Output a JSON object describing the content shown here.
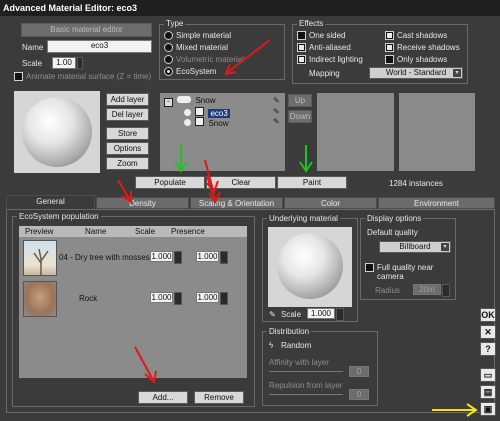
{
  "window": {
    "title": "Advanced Material Editor: eco3"
  },
  "left_panel": {
    "basic_editor_button": "Basic material editor",
    "name_label": "Name",
    "name_value": "eco3",
    "scale_label": "Scale",
    "scale_value": "1.00",
    "animate_label": "Animate material surface (Z = time)",
    "buttons": {
      "add_layer": "Add layer",
      "del_layer": "Del layer",
      "store": "Store",
      "options": "Options",
      "zoom": "Zoom"
    }
  },
  "type_group": {
    "title": "Type",
    "options": [
      "Simple material",
      "Mixed material",
      "Volumetric material",
      "EcoSystem"
    ],
    "selected": "EcoSystem"
  },
  "effects_group": {
    "title": "Effects",
    "left": [
      {
        "label": "One sided",
        "checked": false
      },
      {
        "label": "Anti-aliased",
        "checked": true
      },
      {
        "label": "Indirect lighting",
        "checked": true
      }
    ],
    "right": [
      {
        "label": "Cast shadows",
        "checked": true
      },
      {
        "label": "Receive shadows",
        "checked": true
      },
      {
        "label": "Only shadows",
        "checked": false
      }
    ],
    "mapping_label": "Mapping",
    "mapping_value": "World - Standard"
  },
  "layers": {
    "items": [
      "Snow",
      "eco3",
      "Snow"
    ],
    "up": "Up",
    "down": "Down"
  },
  "actions": {
    "populate": "Populate",
    "clear": "Clear",
    "paint": "Paint",
    "instances": "1284 instances"
  },
  "tabs": [
    "General",
    "Density",
    "Scaling & Orientation",
    "Color",
    "Environment"
  ],
  "population": {
    "title": "EcoSystem population",
    "headers": [
      "Preview",
      "Name",
      "Scale",
      "Presence"
    ],
    "rows": [
      {
        "name": "04 - Dry tree with mosses",
        "scale": "1.000",
        "presence": "1.000"
      },
      {
        "name": "Rock",
        "scale": "1.000",
        "presence": "1.000"
      }
    ],
    "add": "Add...",
    "remove": "Remove"
  },
  "underlying": {
    "title": "Underlying material",
    "scale_label": "Scale",
    "scale_value": "1.000"
  },
  "display_options": {
    "title": "Display options",
    "default_quality_label": "Default quality",
    "quality_value": "Billboard",
    "full_quality_label": "Full quality near camera",
    "radius_label": "Radius",
    "radius_value": "20m"
  },
  "distribution": {
    "title": "Distribution",
    "mode": "Random",
    "affinity_label": "Affinity with layer",
    "affinity_value": "0",
    "repulsion_label": "Repulsion from layer",
    "repulsion_value": "0"
  },
  "side_buttons": {
    "ok": "OK",
    "cancel": "✕",
    "help": "?"
  }
}
